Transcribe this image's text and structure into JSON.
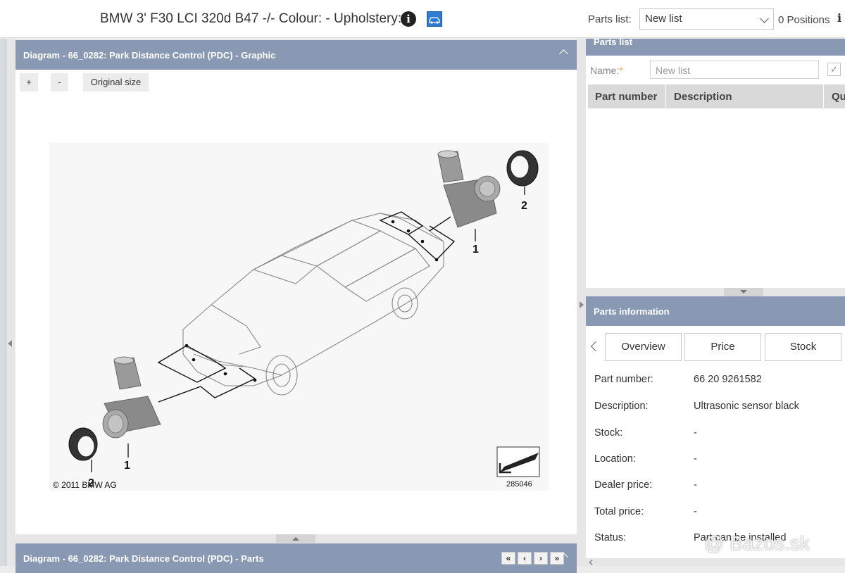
{
  "header": {
    "vehicle_title": "BMW 3' F30 LCI 320d B47 -/- Colour: - Upholstery: -",
    "info_icon_glyph": "i",
    "parts_list_label": "Parts list:",
    "parts_list_selected": "New list",
    "positions": "0 Positions",
    "right_icon_glyph": "i"
  },
  "diagram": {
    "title": "Diagram - 66_0282: Park Distance Control (PDC) - Graphic",
    "zoom_in": "+",
    "zoom_out": "-",
    "original_size": "Original size",
    "callout_1": "1",
    "callout_2": "2",
    "copyright": "© 2011 BMW AG",
    "image_number": "285046"
  },
  "parts_panel": {
    "title": "Diagram - 66_0282: Park Distance Control (PDC) - Parts",
    "nav": [
      "«",
      "‹",
      "›",
      "»"
    ]
  },
  "parts_list": {
    "title": "Parts list",
    "name_label": "Name:",
    "name_required": "*",
    "name_placeholder": "New list",
    "columns": [
      "Part number",
      "Description",
      "Qu"
    ]
  },
  "parts_information": {
    "title": "Parts information",
    "tabs": [
      "Overview",
      "Price",
      "Stock"
    ],
    "rows": [
      {
        "label": "Part number:",
        "value": "66 20 9261582"
      },
      {
        "label": "Description:",
        "value": "Ultrasonic sensor black"
      },
      {
        "label": "Stock:",
        "value": "-"
      },
      {
        "label": "Location:",
        "value": "-"
      },
      {
        "label": "Dealer price:",
        "value": "-"
      },
      {
        "label": "Total price:",
        "value": "-"
      },
      {
        "label": "Status:",
        "value": "Part can be installed"
      }
    ]
  },
  "watermark": "@ Bazos.sk",
  "icons": {
    "info": "info-icon",
    "vehicle": "car-icon",
    "dropdown": "chevron-down-icon",
    "collapse": "chevron-up-icon",
    "check": "check-icon"
  },
  "colors": {
    "panel_header": "#8999b3",
    "accent_required": "#f4a23c"
  }
}
